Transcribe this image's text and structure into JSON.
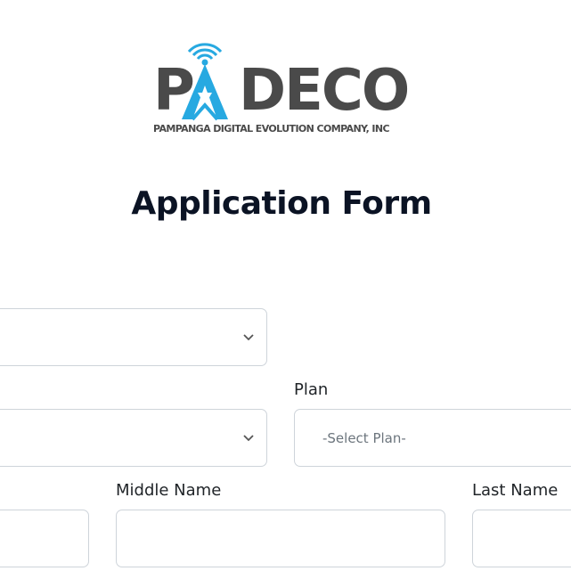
{
  "logo": {
    "letter_p": "P",
    "word_rest": "DECO",
    "tagline": "PAMPANGA DIGITAL EVOLUTION COMPANY, INC",
    "brand_colors": {
      "dark": "#4a4a4a",
      "accent": "#27a9e1"
    }
  },
  "page": {
    "title": "Application Form"
  },
  "form": {
    "plan": {
      "label": "Plan",
      "selected": "-Select Plan-"
    },
    "middle_name": {
      "label": "Middle Name",
      "value": ""
    },
    "last_name": {
      "label": "Last Name",
      "value": ""
    },
    "icons": {
      "select_arrow": "chevron-down-icon"
    }
  }
}
